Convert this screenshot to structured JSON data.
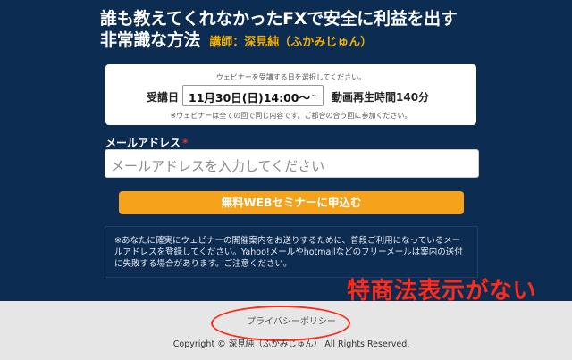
{
  "header": {
    "title_line1": "誰も教えてくれなかったFXで安全に利益を出す",
    "title_line2": "非常識な方法",
    "lecturer": "講師：深見純（ふかみじゅん）"
  },
  "session_card": {
    "instruction": "ウェビナーを受講する日を選択してください。",
    "session_label": "受講日",
    "selected_session": "11月30日(日)14:00〜",
    "duration": "動画再生時間140分",
    "note": "※ウェビナーは全ての回で同じ内容です。ご都合の合う回に参加ください。"
  },
  "form": {
    "email_label": "メールアドレス",
    "required_mark": "*",
    "email_placeholder": "メールアドレスを入力してください",
    "submit_label": "無料WEBセミナーに申込む"
  },
  "notice": {
    "text": "※あなたに確実にウェビナーの開催案内をお送りするために、普段ご利用になっているメールアドレスを登録してください。Yahoo!メールやhotmailなどのフリーメールは案内の送付に失敗する場合があります。ご注意ください。"
  },
  "annotation": {
    "text": "特商法表示がない",
    "color": "#ff2a1a"
  },
  "footer": {
    "privacy_link": "プライバシーポリシー",
    "copyright": "Copyright © 深見純（ふかみじゅん） All Rights Reserved."
  },
  "colors": {
    "hero_bg": "#0d2c52",
    "accent_button": "#f7a21b",
    "lecturer_text": "#f0b000"
  }
}
